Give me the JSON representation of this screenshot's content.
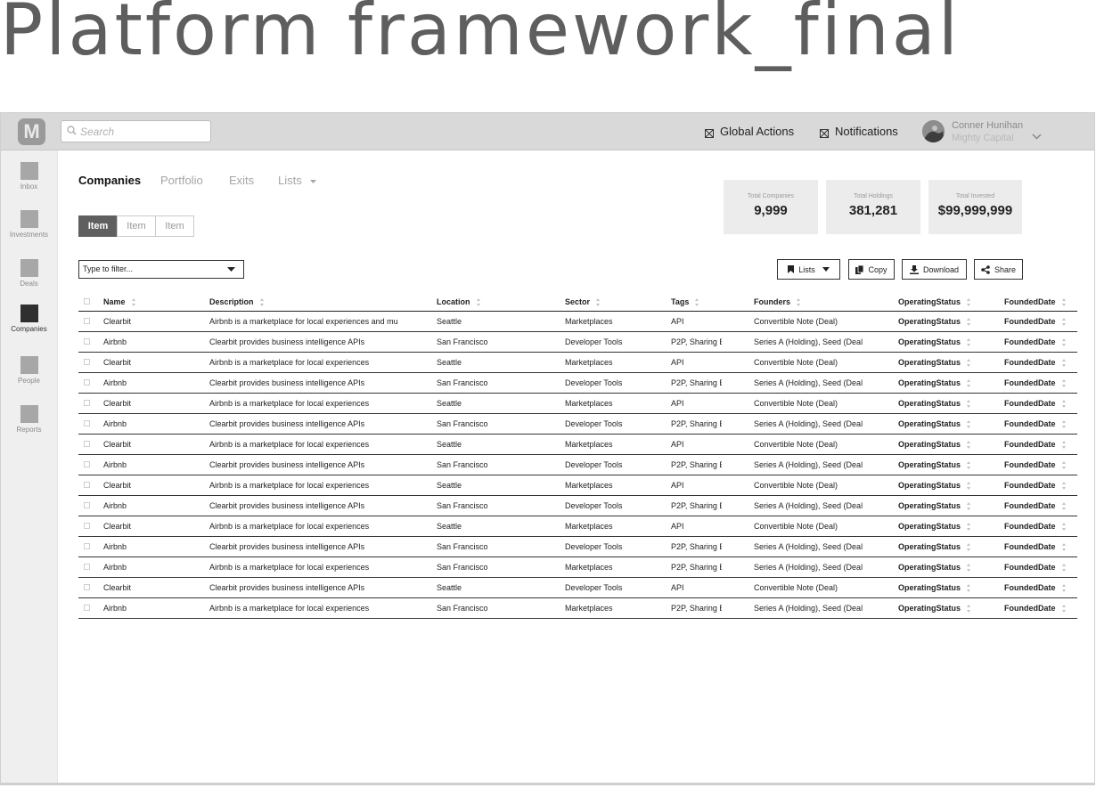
{
  "page_title": "Platform framework_final",
  "app": {
    "logo_letter": "M"
  },
  "search": {
    "placeholder": "Search"
  },
  "top_actions": {
    "global_actions": "Global Actions",
    "notifications": "Notifications"
  },
  "user": {
    "name": "Conner Hunihan",
    "org": "Mighty Capital"
  },
  "sidebar": {
    "items": [
      {
        "label": "Inbox",
        "active": false
      },
      {
        "label": "Investments",
        "active": false
      },
      {
        "label": "Deals",
        "active": false
      },
      {
        "label": "Companies",
        "active": true
      },
      {
        "label": "People",
        "active": false
      },
      {
        "label": "Reports",
        "active": false
      }
    ]
  },
  "tabs": [
    {
      "label": "Companies",
      "active": true
    },
    {
      "label": "Portfolio",
      "active": false
    },
    {
      "label": "Exits",
      "active": false
    },
    {
      "label": "Lists",
      "active": false
    }
  ],
  "segments": [
    {
      "label": "Item",
      "active": true
    },
    {
      "label": "Item",
      "active": false
    },
    {
      "label": "Item",
      "active": false
    }
  ],
  "stats": [
    {
      "label": "Total Companies",
      "value": "9,999"
    },
    {
      "label": "Total Holdings",
      "value": "381,281"
    },
    {
      "label": "Total Invested",
      "value": "$99,999,999"
    }
  ],
  "filter": {
    "placeholder": "Type to filter..."
  },
  "toolbar": {
    "lists": "Lists",
    "copy": "Copy",
    "download": "Download",
    "share": "Share"
  },
  "table": {
    "columns": [
      "Name",
      "Description",
      "Location",
      "Sector",
      "Tags",
      "Founders",
      "OperatingStatus",
      "FoundedDate"
    ],
    "rows": [
      [
        "Clearbit",
        "Airbnb is a marketplace for local experiences and mu",
        "Seattle",
        "Marketplaces",
        "API",
        "Convertible Note (Deal)",
        "OperatingStatus",
        "FoundedDate"
      ],
      [
        "Airbnb",
        "Clearbit provides business intelligence APIs",
        "San Francisco",
        "Developer Tools",
        "P2P, Sharing E",
        "Series A (Holding), Seed (Deal",
        "OperatingStatus",
        "FoundedDate"
      ],
      [
        "Clearbit",
        "Airbnb is a marketplace for local experiences",
        "Seattle",
        "Marketplaces",
        "API",
        "Convertible Note (Deal)",
        "OperatingStatus",
        "FoundedDate"
      ],
      [
        "Airbnb",
        "Clearbit provides business intelligence APIs",
        "San Francisco",
        "Developer Tools",
        "P2P, Sharing E",
        "Series A (Holding), Seed (Deal",
        "OperatingStatus",
        "FoundedDate"
      ],
      [
        "Clearbit",
        "Airbnb is a marketplace for local experiences",
        "Seattle",
        "Marketplaces",
        "API",
        "Convertible Note (Deal)",
        "OperatingStatus",
        "FoundedDate"
      ],
      [
        "Airbnb",
        "Clearbit provides business intelligence APIs",
        "San Francisco",
        "Developer Tools",
        "P2P, Sharing E",
        "Series A (Holding), Seed (Deal",
        "OperatingStatus",
        "FoundedDate"
      ],
      [
        "Clearbit",
        "Airbnb is a marketplace for local experiences",
        "Seattle",
        "Marketplaces",
        "API",
        "Convertible Note (Deal)",
        "OperatingStatus",
        "FoundedDate"
      ],
      [
        "Airbnb",
        "Clearbit provides business intelligence APIs",
        "San Francisco",
        "Developer Tools",
        "P2P, Sharing E",
        "Series A (Holding), Seed (Deal",
        "OperatingStatus",
        "FoundedDate"
      ],
      [
        "Clearbit",
        "Airbnb is a marketplace for local experiences",
        "Seattle",
        "Marketplaces",
        "API",
        "Convertible Note (Deal)",
        "OperatingStatus",
        "FoundedDate"
      ],
      [
        "Airbnb",
        "Clearbit provides business intelligence APIs",
        "San Francisco",
        "Developer Tools",
        "P2P, Sharing E",
        "Series A (Holding), Seed (Deal",
        "OperatingStatus",
        "FoundedDate"
      ],
      [
        "Clearbit",
        "Airbnb is a marketplace for local experiences",
        "Seattle",
        "Marketplaces",
        "API",
        "Convertible Note (Deal)",
        "OperatingStatus",
        "FoundedDate"
      ],
      [
        "Airbnb",
        "Clearbit provides business intelligence APIs",
        "San Francisco",
        "Developer Tools",
        "P2P, Sharing E",
        "Series A (Holding), Seed (Deal",
        "OperatingStatus",
        "FoundedDate"
      ],
      [
        "Airbnb",
        "Airbnb is a marketplace for local experiences",
        "San Francisco",
        "Marketplaces",
        "P2P, Sharing E",
        "Series A (Holding), Seed (Deal",
        "OperatingStatus",
        "FoundedDate"
      ],
      [
        "Clearbit",
        "Clearbit provides business intelligence APIs",
        "Seattle",
        "Developer Tools",
        "API",
        "Convertible Note (Deal)",
        "OperatingStatus",
        "FoundedDate"
      ],
      [
        "Airbnb",
        "Airbnb is a marketplace for local experiences",
        "San Francisco",
        "Marketplaces",
        "P2P, Sharing E",
        "Series A (Holding), Seed (Deal",
        "OperatingStatus",
        "FoundedDate"
      ]
    ]
  }
}
